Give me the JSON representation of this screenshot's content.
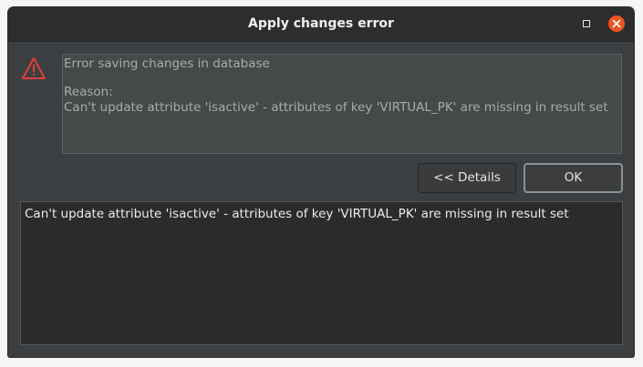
{
  "window": {
    "title": "Apply changes error"
  },
  "titlebar": {
    "maximize_icon": "maximize-icon",
    "close_icon": "close-icon"
  },
  "message": {
    "icon": "warning-triangle-icon",
    "icon_color": "#e0403a",
    "line1": "Error saving changes in database",
    "line2": "Reason:",
    "line3": "Can't update attribute 'isactive' - attributes of key 'VIRTUAL_PK' are missing in result set"
  },
  "buttons": {
    "details_label": "<< Details",
    "ok_label": "OK"
  },
  "details": {
    "text": "Can't update attribute 'isactive' - attributes of key 'VIRTUAL_PK' are missing in result set"
  },
  "colors": {
    "window_bg": "#3c3f41",
    "titlebar_bg": "#2d2d2d",
    "close_button": "#e95420",
    "details_bg": "#2b2b2b"
  }
}
